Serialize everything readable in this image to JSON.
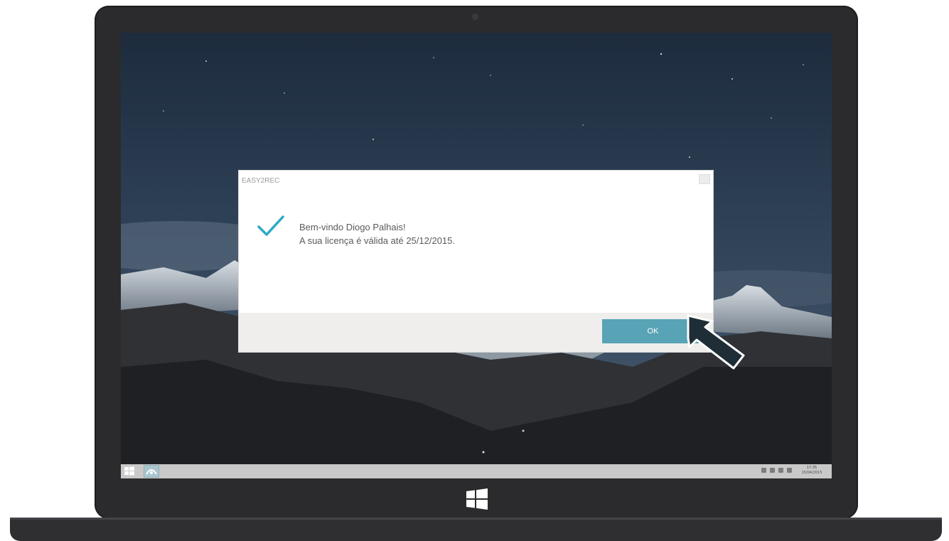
{
  "dialog": {
    "title": "EASY2REC",
    "line1": "Bem-vindo Diogo Palhais!",
    "line2": "A sua licença é válida até 25/12/2015.",
    "ok_label": "OK"
  },
  "taskbar": {
    "clock_time": "17:35",
    "clock_date": "15/04/2015"
  },
  "colors": {
    "accent": "#58a3b5",
    "check": "#2fa9c6"
  },
  "icons": {
    "status": "checkmark-icon",
    "pointer": "arrow-pointer-icon",
    "start": "windows-logo-icon"
  }
}
